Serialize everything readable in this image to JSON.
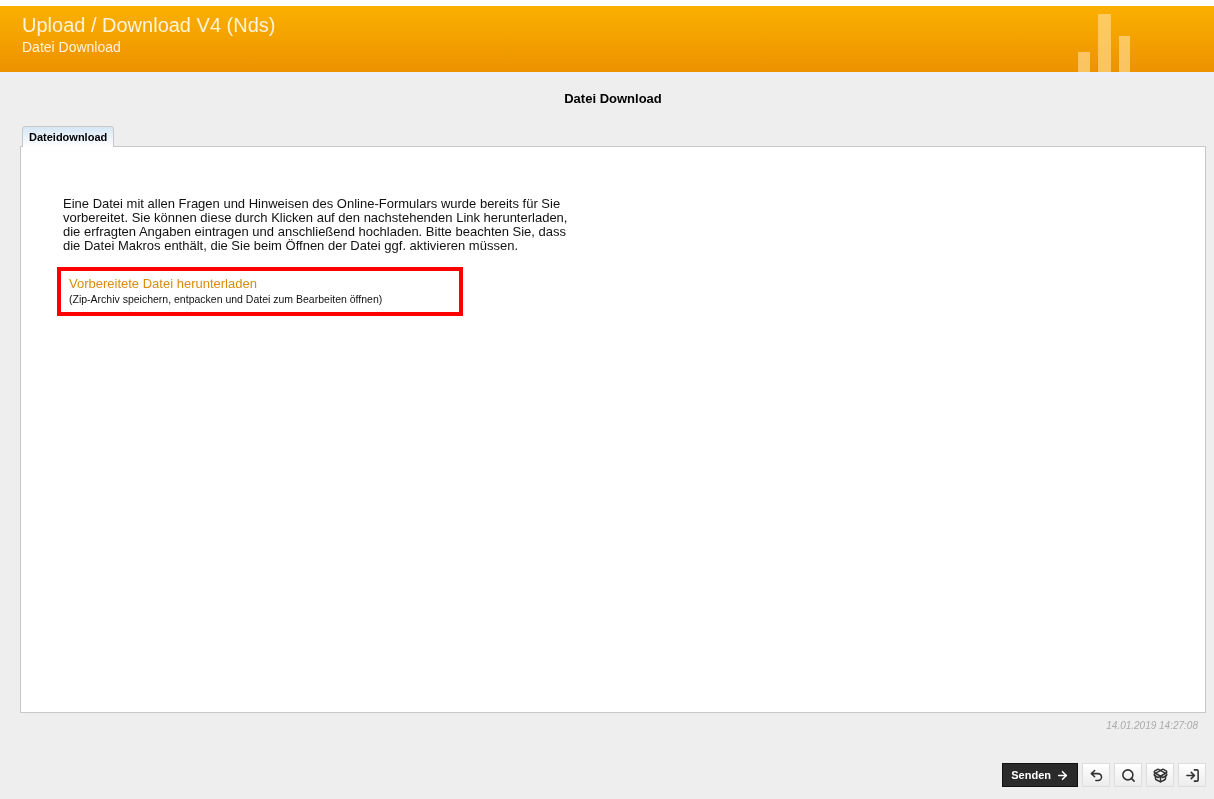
{
  "header": {
    "title": "Upload / Download V4 (Nds)",
    "subtitle": "Datei Download"
  },
  "page_title": "Datei Download",
  "tabs": [
    {
      "label": "Dateidownload",
      "selected": true
    }
  ],
  "intro": "Eine Datei mit allen Fragen und Hinweisen des Online-Formulars wurde bereits für Sie vorbereitet. Sie können diese durch Klicken auf den nachstehenden Link herunterladen, die erfragten Angaben eintragen und anschließend hochladen. Bitte beachten Sie, dass die Datei Makros enthält, die Sie beim Öffnen der Datei ggf. aktivieren müssen.",
  "download": {
    "link": "Vorbereitete Datei herunterladen",
    "hint": "(Zip-Archiv speichern, entpacken und Datei zum Bearbeiten öffnen)"
  },
  "timestamp": "14.01.2019 14:27:08",
  "toolbar": [
    {
      "kind": "send",
      "label": "Senden"
    },
    {
      "kind": "undo"
    },
    {
      "kind": "search"
    },
    {
      "kind": "package"
    },
    {
      "kind": "exit"
    }
  ]
}
